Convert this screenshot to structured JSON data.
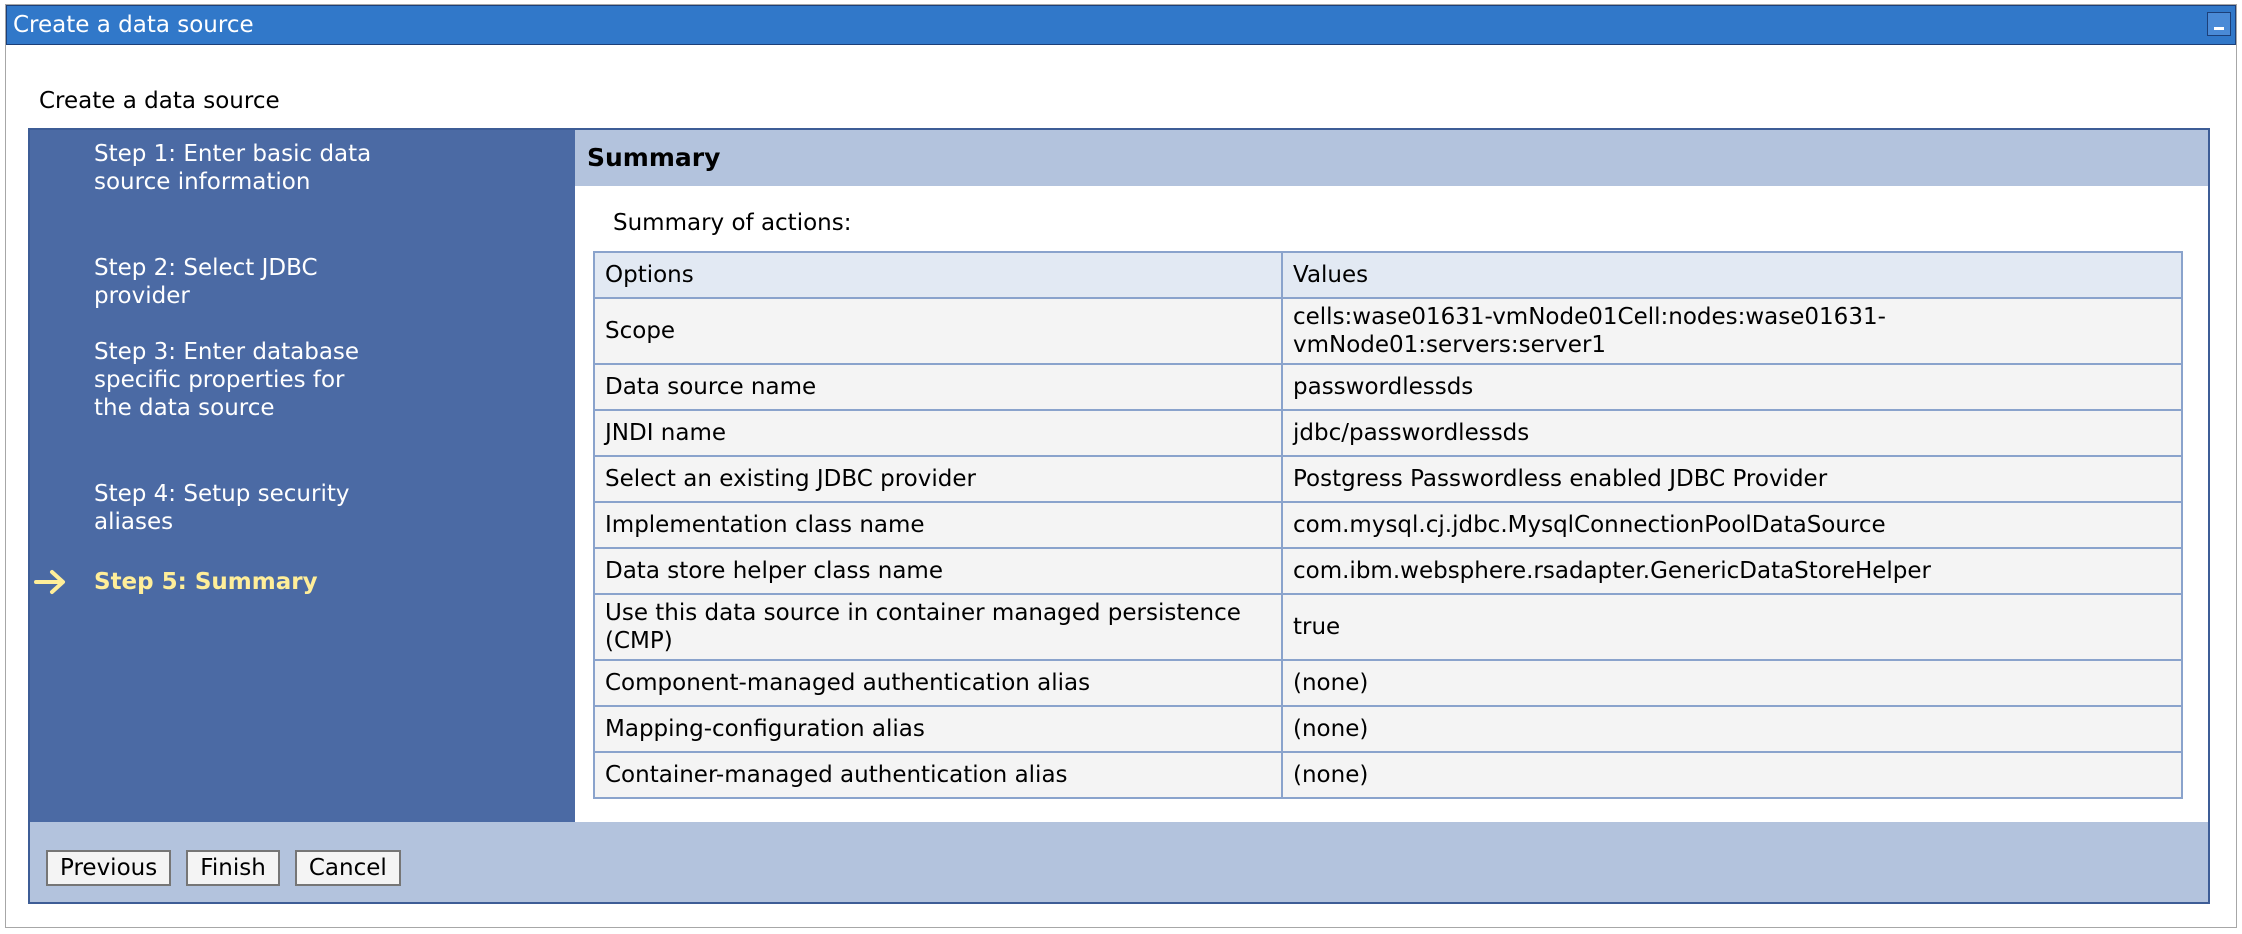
{
  "window": {
    "title": "Create a data source"
  },
  "page": {
    "heading": "Create a data source"
  },
  "steps": [
    {
      "label": "Step 1: Enter basic data source information",
      "current": false
    },
    {
      "label": "Step 2: Select JDBC provider",
      "current": false
    },
    {
      "label": "Step 3: Enter database specific properties for the data source",
      "current": false
    },
    {
      "label": "Step 4: Setup security aliases",
      "current": false
    },
    {
      "label": "Step 5: Summary",
      "current": true
    }
  ],
  "summary": {
    "header": "Summary",
    "subtitle": "Summary of actions:",
    "columns": [
      "Options",
      "Values"
    ],
    "rows": [
      [
        "Scope",
        "cells:wase01631-vmNode01Cell:nodes:wase01631-vmNode01:servers:server1"
      ],
      [
        "Data source name",
        "passwordlessds"
      ],
      [
        "JNDI name",
        "jdbc/passwordlessds"
      ],
      [
        "Select an existing JDBC provider",
        "Postgress Passwordless enabled JDBC Provider"
      ],
      [
        "Implementation class name",
        "com.mysql.cj.jdbc.MysqlConnectionPoolDataSource"
      ],
      [
        "Data store helper class name",
        "com.ibm.websphere.rsadapter.GenericDataStoreHelper"
      ],
      [
        "Use this data source in container managed persistence (CMP)",
        "true"
      ],
      [
        "Component-managed authentication alias",
        "(none)"
      ],
      [
        "Mapping-configuration alias",
        "(none)"
      ],
      [
        "Container-managed authentication alias",
        "(none)"
      ]
    ]
  },
  "buttons": {
    "previous": "Previous",
    "finish": "Finish",
    "cancel": "Cancel"
  },
  "colors": {
    "titlebar": "#3178c9",
    "steps_panel": "#4b6aa4",
    "current_step": "#ffee99",
    "header_band": "#b3c3dd"
  },
  "icons": {
    "current_step": "right-arrow-icon",
    "minimize": "minimize-icon"
  }
}
